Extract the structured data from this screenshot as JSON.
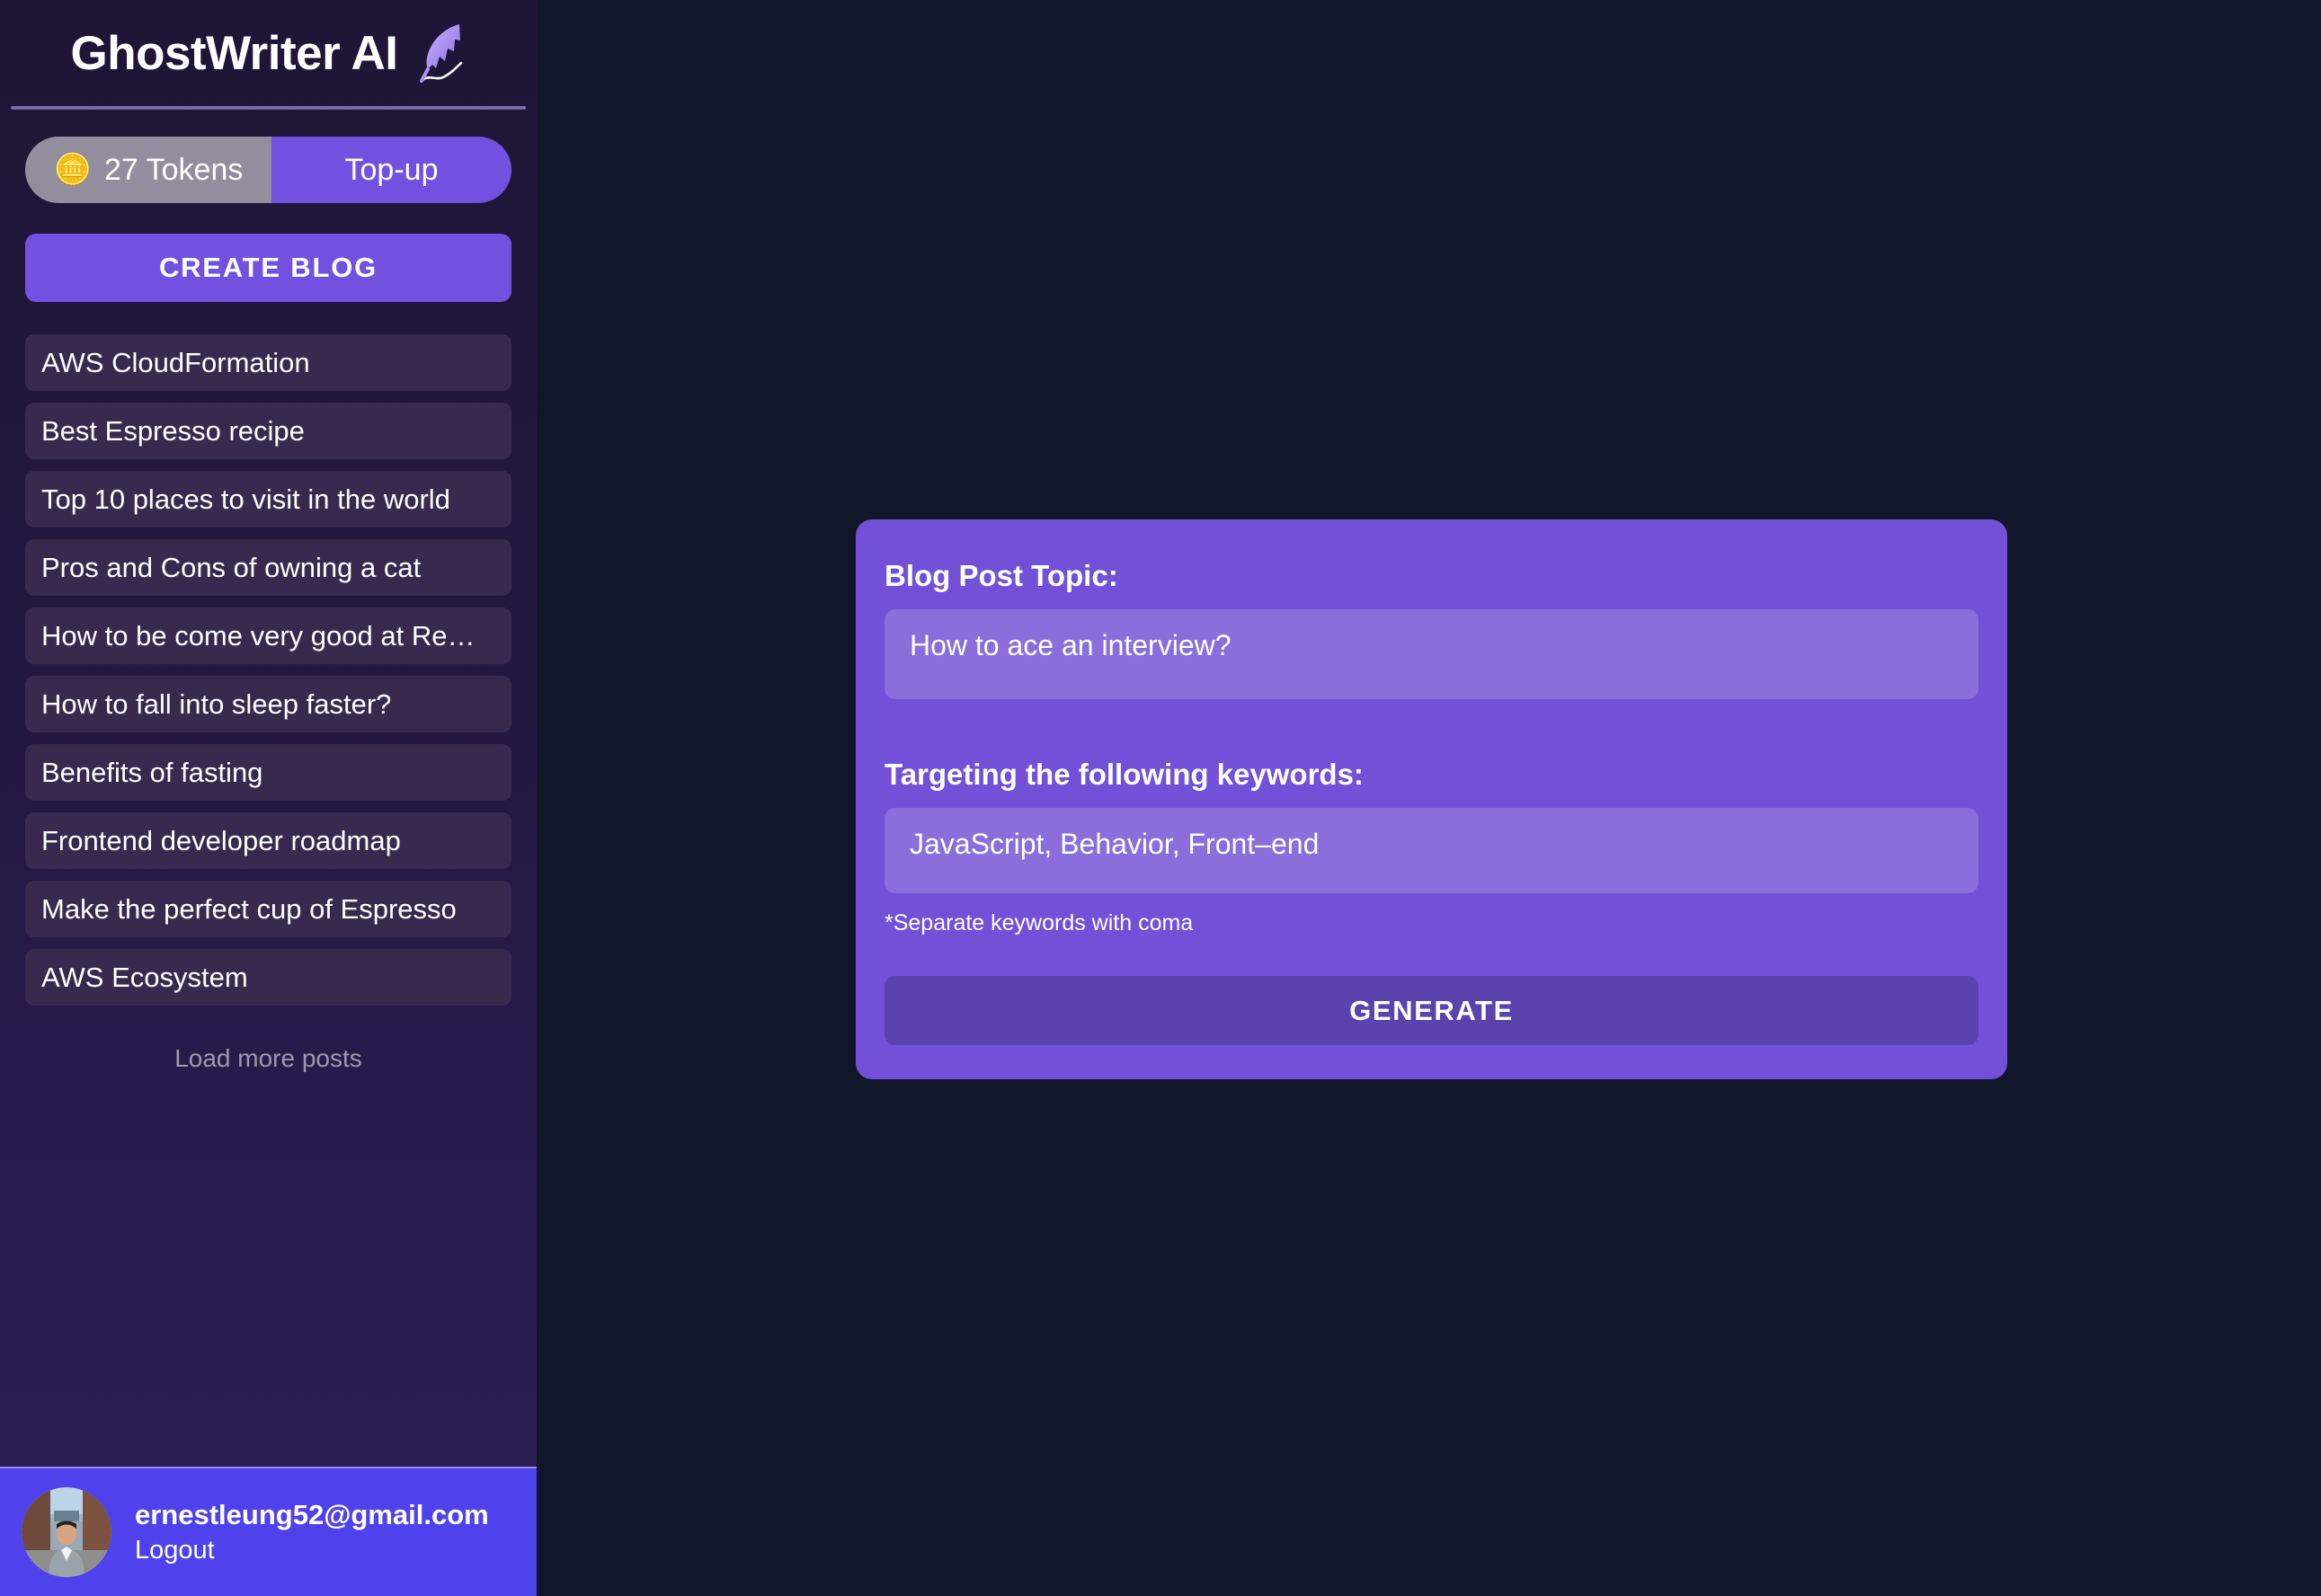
{
  "app": {
    "brand_title": "GhostWriter AI",
    "brand_icon": "quill-feather-icon"
  },
  "sidebar": {
    "tokens": {
      "icon": "coin-stack-icon",
      "count_label": "27 Tokens",
      "topup_label": "Top-up"
    },
    "create_blog_label": "CREATE BLOG",
    "posts": [
      {
        "title": "AWS CloudFormation"
      },
      {
        "title": "Best Espresso recipe"
      },
      {
        "title": "Top 10 places to visit in the world"
      },
      {
        "title": "Pros and Cons of owning a cat"
      },
      {
        "title": "How to be come very good at Re…"
      },
      {
        "title": "How to fall into sleep faster?"
      },
      {
        "title": "Benefits of fasting"
      },
      {
        "title": "Frontend developer roadmap"
      },
      {
        "title": "Make the perfect cup of Espresso"
      },
      {
        "title": "AWS Ecosystem"
      }
    ],
    "load_more_label": "Load more posts",
    "user": {
      "avatar_name": "user-avatar-photo",
      "email": "ernestleung52@gmail.com",
      "logout_label": "Logout"
    }
  },
  "main": {
    "form": {
      "topic_label": "Blog Post Topic:",
      "topic_value": "How to ace an interview?",
      "topic_placeholder": "How to ace an interview?",
      "keywords_label": "Targeting the following keywords:",
      "keywords_value": "JavaScript, Behavior, Front–end",
      "keywords_placeholder": "JavaScript, Behavior, Front-end",
      "hint": "*Separate keywords with coma",
      "generate_label": "GENERATE"
    }
  },
  "colors": {
    "page_background": "#111729",
    "sidebar_top": "#1f1536",
    "sidebar_bottom": "#2d1f55",
    "post_item": "#382a4f",
    "accent_purple": "#7351e0",
    "card_purple": "#7250d8",
    "input_purple": "#8a6edc",
    "generate_purple": "#5b42ad",
    "footer_blue": "#4f41ec",
    "token_gray": "#938e9e",
    "muted_text": "#9e99ae"
  }
}
